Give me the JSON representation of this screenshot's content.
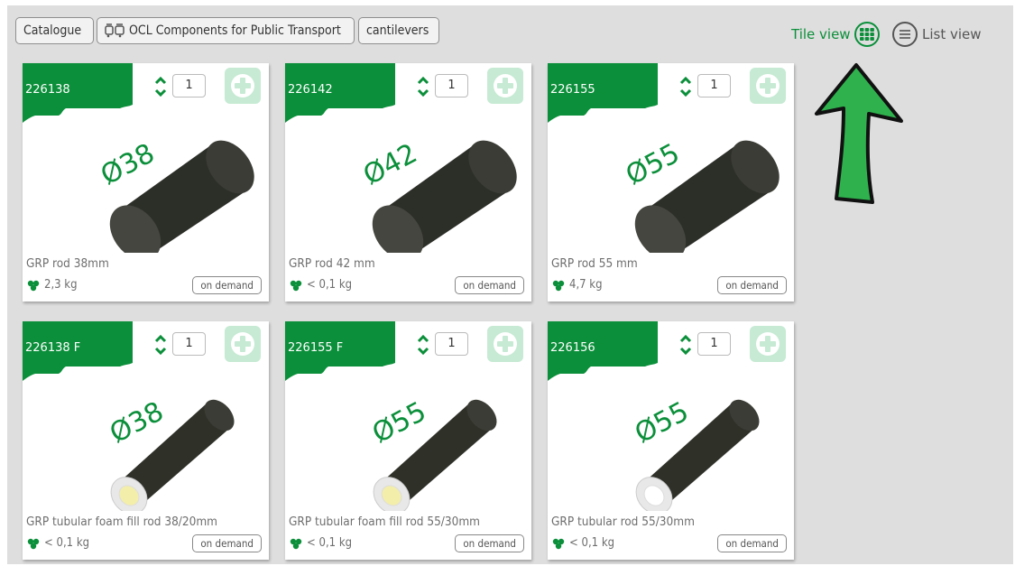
{
  "breadcrumb": {
    "items": [
      {
        "label": "Catalogue",
        "icon": ""
      },
      {
        "label": "OCL Components for Public Transport",
        "icon": "bus-icon"
      },
      {
        "label": "cantilevers",
        "icon": ""
      }
    ]
  },
  "view_toggle": {
    "tile_label": "Tile view",
    "list_label": "List view",
    "active": "tile"
  },
  "colors": {
    "brand_green": "#0b8f3a",
    "add_button": "#c6ead3",
    "annotation_arrow": "#2fb24e"
  },
  "products": [
    {
      "code": "226138",
      "qty": "1",
      "diameter_label": "Ø38",
      "name": "GRP rod 38mm",
      "weight": "2,3 kg",
      "availability": "on demand",
      "type": "solid"
    },
    {
      "code": "226142",
      "qty": "1",
      "diameter_label": "Ø42",
      "name": "GRP rod 42 mm",
      "weight": "< 0,1 kg",
      "availability": "on demand",
      "type": "solid"
    },
    {
      "code": "226155",
      "qty": "1",
      "diameter_label": "Ø55",
      "name": "GRP rod 55 mm",
      "weight": "4,7 kg",
      "availability": "on demand",
      "type": "solid"
    },
    {
      "code": "226138 F",
      "qty": "1",
      "diameter_label": "Ø38",
      "name": "GRP tubular foam fill rod 38/20mm",
      "weight": "< 0,1 kg",
      "availability": "on demand",
      "type": "foam"
    },
    {
      "code": "226155 F",
      "qty": "1",
      "diameter_label": "Ø55",
      "name": "GRP tubular foam fill rod 55/30mm",
      "weight": "< 0,1 kg",
      "availability": "on demand",
      "type": "foam"
    },
    {
      "code": "226156",
      "qty": "1",
      "diameter_label": "Ø55",
      "name": "GRP tubular rod 55/30mm",
      "weight": "< 0,1 kg",
      "availability": "on demand",
      "type": "hollow"
    }
  ]
}
